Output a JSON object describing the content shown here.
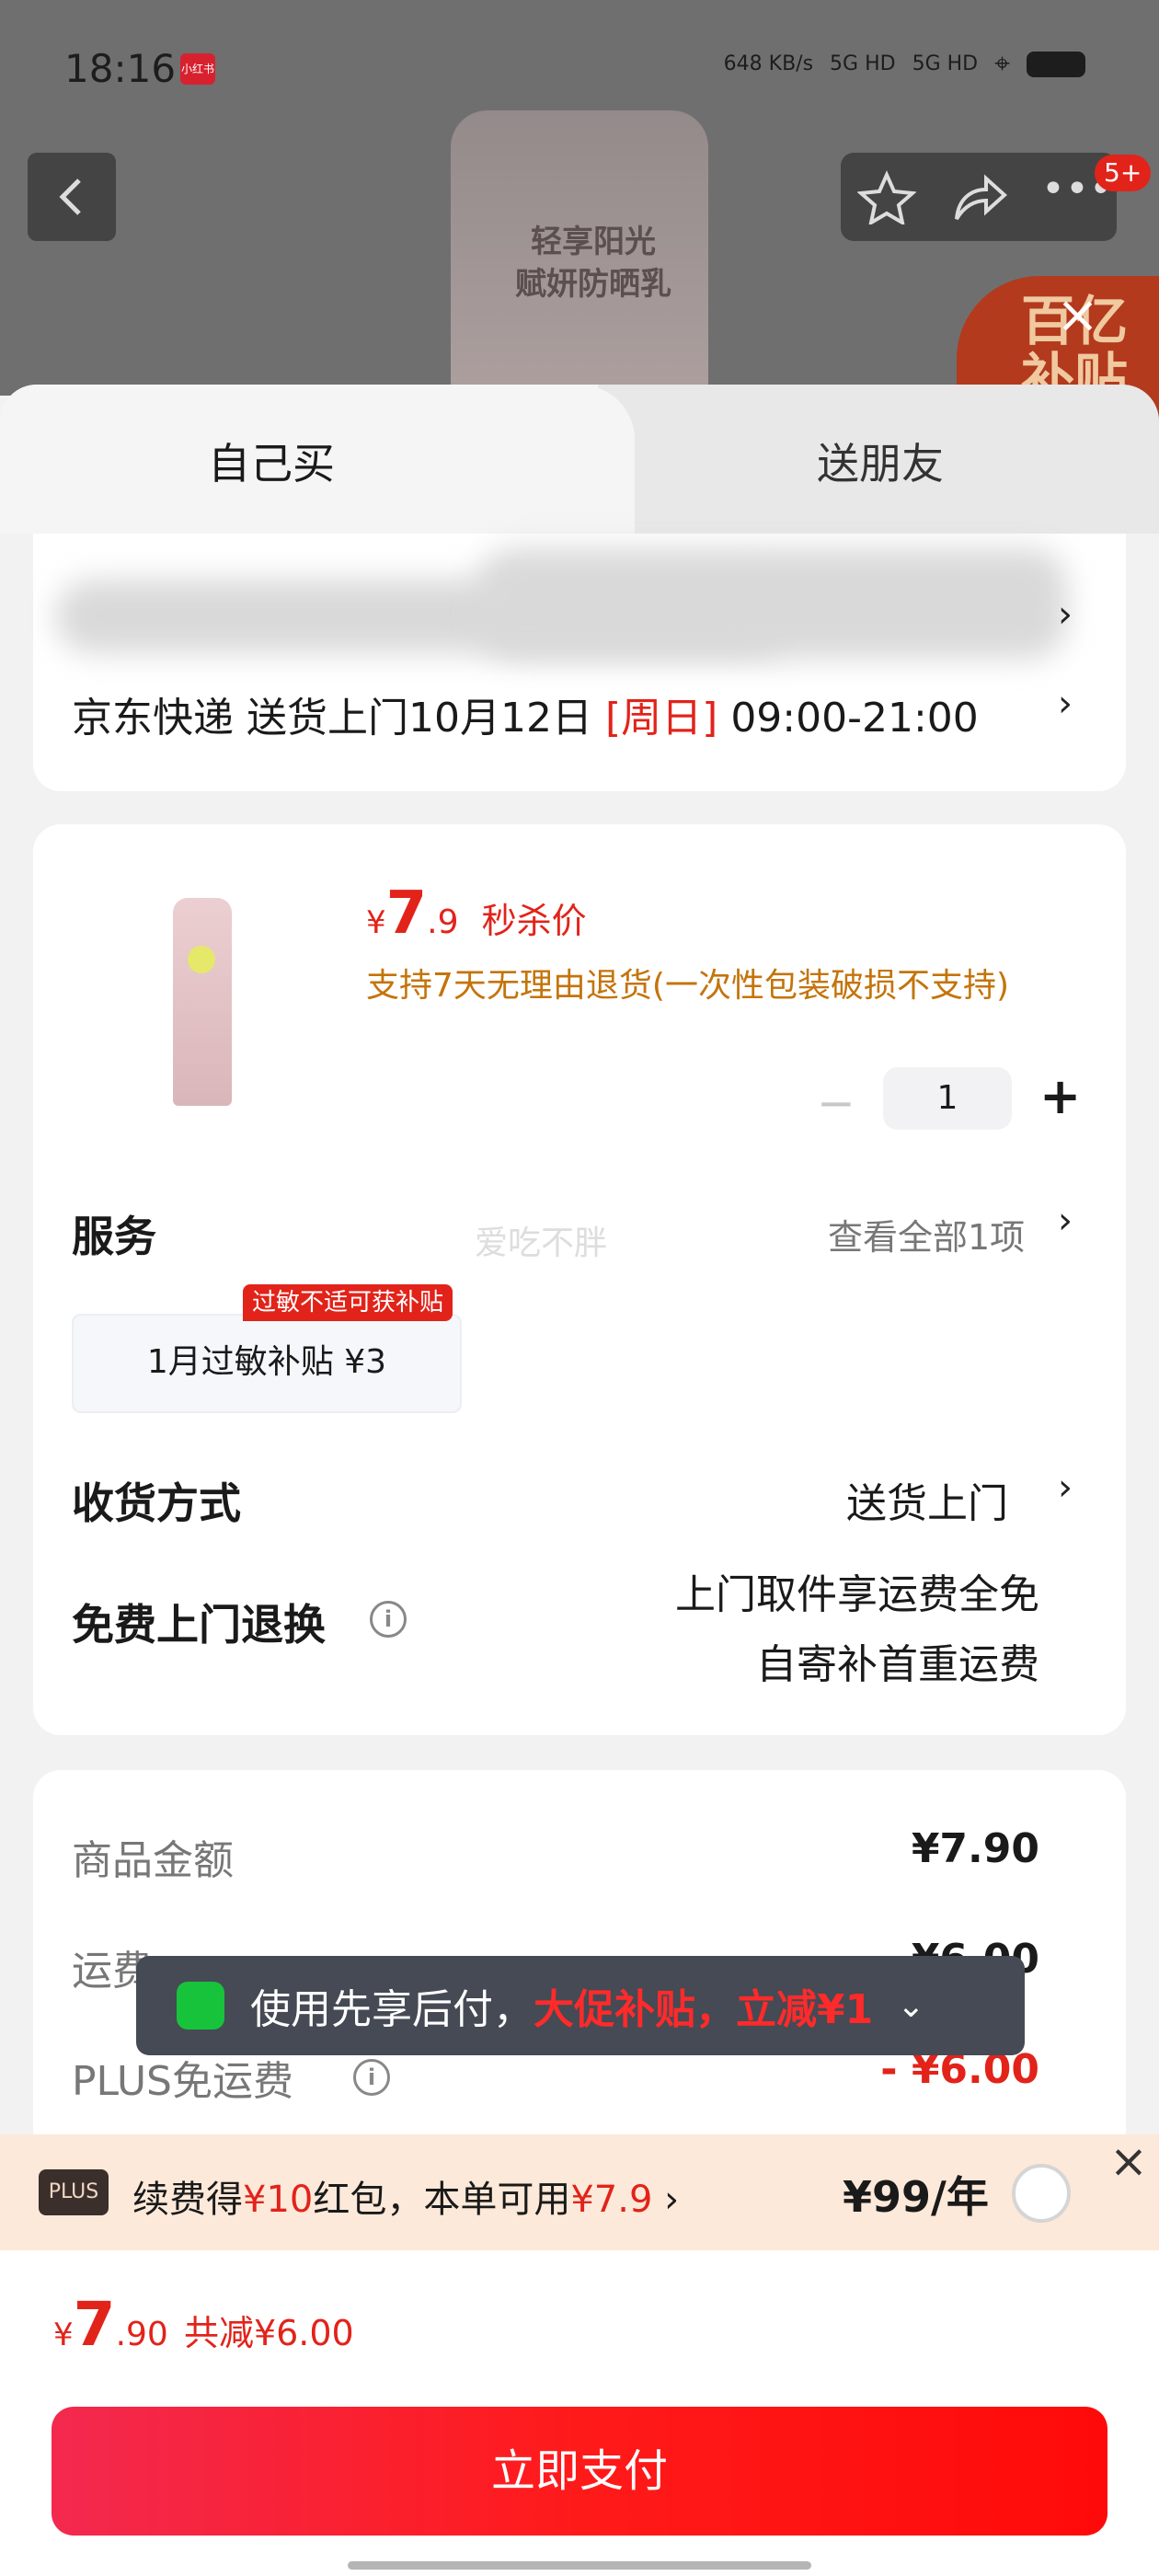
{
  "status_bar": {
    "time": "18:16",
    "net_speed": "648 KB/s",
    "signal_1": "5G HD",
    "signal_2": "5G HD",
    "app_badge": "小红书"
  },
  "top_nav": {
    "more_badge": "5+"
  },
  "background": {
    "product_tube_text": "轻享阳光\n赋妍防晒乳",
    "promo_badge": "百亿\n补贴"
  },
  "tabs": [
    {
      "label": "自己买"
    },
    {
      "label": "送朋友"
    }
  ],
  "delivery": {
    "line": "京东快递 送货上门10月12日",
    "weekday": "[周日]",
    "time_range": "09:00-21:00"
  },
  "product": {
    "currency": "¥",
    "price_int": "7",
    "price_dec": ".9",
    "price_tag": "秒杀价",
    "return_policy": "支持7天无理由退货(一次性包装破损不支持)",
    "quantity": "1",
    "watermark": "爱吃不胖"
  },
  "service": {
    "title": "服务",
    "view_all": "查看全部1项",
    "tag": "过敏不适可获补贴",
    "tile": "1月过敏补贴  ¥3"
  },
  "shipping": {
    "title": "收货方式",
    "value": "送货上门"
  },
  "free_return": {
    "title": "免费上门退换",
    "line1": "上门取件享运费全免",
    "line2": "自寄补首重运费"
  },
  "amounts": {
    "goods_label": "商品金额",
    "goods_value": "¥7.90",
    "freight_label": "运费",
    "freight_value": "¥6.00",
    "plus_free_label": "PLUS免运费",
    "plus_free_value": "- ¥6.00"
  },
  "toast": {
    "text": "使用先享后付，",
    "highlight": "大促补贴，立减¥1"
  },
  "plus_bar": {
    "badge": "PLUS",
    "text_a": "续费得",
    "text_b": "¥10",
    "text_c": "红包，本单可用",
    "text_d": "¥7.9",
    "price": "¥99/年"
  },
  "footer": {
    "currency": "¥",
    "total_int": "7",
    "total_dec": ".90",
    "discount": "共减¥6.00",
    "pay_button": "立即支付"
  },
  "colors": {
    "accent_red": "#e2231a",
    "orange": "#c4740b",
    "toast_bg": "#454a54",
    "plus_bar_bg": "#fde9d9"
  }
}
